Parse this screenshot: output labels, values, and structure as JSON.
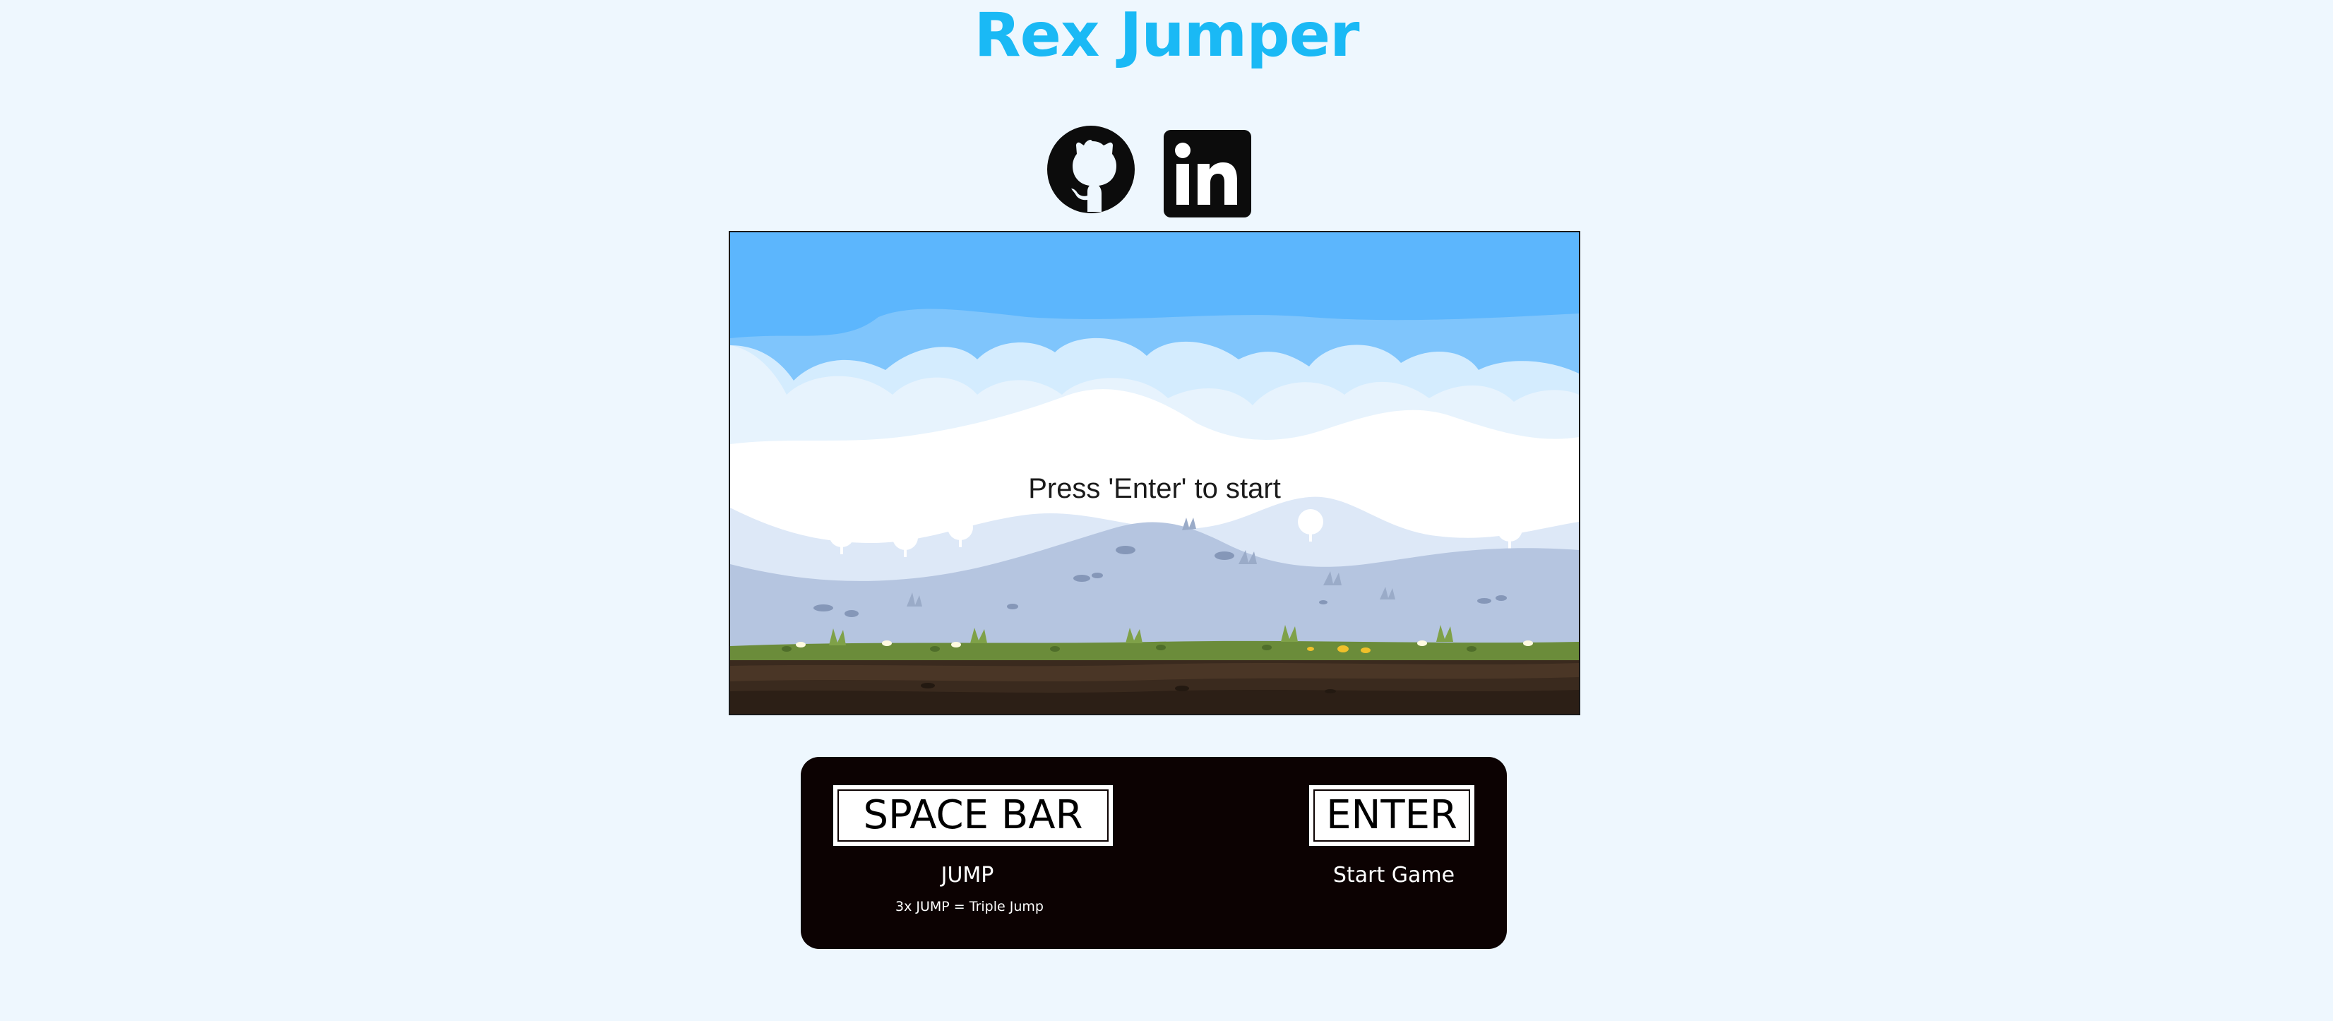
{
  "title": "Rex Jumper",
  "social": {
    "github_icon": "github-icon",
    "linkedin_icon": "linkedin-icon"
  },
  "game": {
    "start_message": "Press 'Enter' to start"
  },
  "controls": {
    "space_key": "SPACE BAR",
    "space_action": "JUMP",
    "space_hint": "3x JUMP = Triple Jump",
    "enter_key": "ENTER",
    "enter_action": "Start Game"
  },
  "colors": {
    "page_bg": "#eef7fe",
    "title": "#1ab9f5",
    "controls_bg": "#0c0202",
    "sky": "#5cb6fd",
    "grass": "#6b8c3a",
    "soil": "#3a2a1e"
  }
}
